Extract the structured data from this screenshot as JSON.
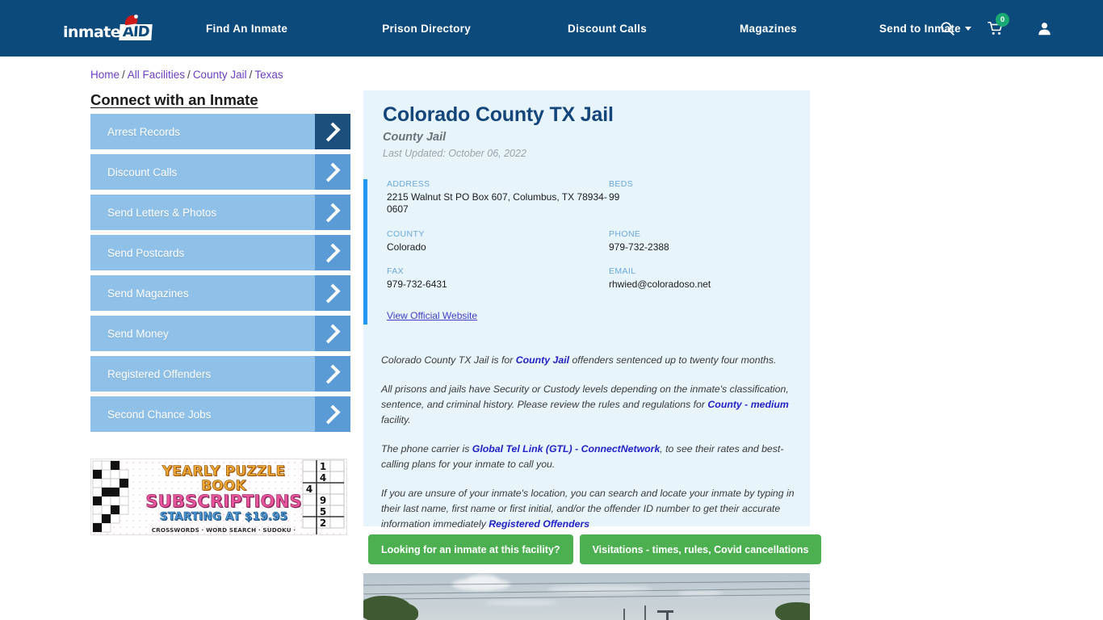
{
  "header": {
    "logo": {
      "text_primary": "inmate",
      "text_secondary": "AID",
      "icon": "santa-hat-icon"
    },
    "nav": [
      {
        "label": "Find An Inmate"
      },
      {
        "label": "Prison Directory"
      },
      {
        "label": "Discount Calls"
      },
      {
        "label": "Magazines"
      },
      {
        "label": "Send to Inmate"
      }
    ],
    "icons": {
      "search": "search-icon",
      "cart": "shopping-cart-icon",
      "cart_count": "0",
      "account": "user-account-icon"
    },
    "colors": {
      "background": "#0d4a7c",
      "badge": "#19a974"
    }
  },
  "breadcrumb": {
    "items": [
      "Home",
      "All Facilities",
      "County Jail",
      "Texas"
    ],
    "separator": "/"
  },
  "sidebar": {
    "title": "Connect with an Inmate",
    "items": [
      {
        "label": "Arrest Records"
      },
      {
        "label": "Discount Calls"
      },
      {
        "label": "Send Letters & Photos"
      },
      {
        "label": "Send Postcards"
      },
      {
        "label": "Send Magazines"
      },
      {
        "label": "Send Money"
      },
      {
        "label": "Registered Offenders"
      },
      {
        "label": "Second Chance Jobs"
      }
    ],
    "ad": {
      "line1": "YEARLY PUZZLE BOOK",
      "line2": "SUBSCRIPTIONS",
      "line3": "STARTING AT $19.95",
      "line4": "CROSSWORDS · WORD SEARCH · SUDOKU · BRAIN TEASERS",
      "sudoku_digits": [
        "1",
        "4",
        "4",
        "9",
        "5",
        "2"
      ]
    }
  },
  "facility": {
    "title": "Colorado County TX Jail",
    "subtitle": "County Jail",
    "last_updated": "Last Updated: October 06, 2022",
    "fields": [
      {
        "label": "ADDRESS",
        "value": "2215 Walnut St PO Box 607, Columbus, TX 78934-0607"
      },
      {
        "label": "BEDS",
        "value": "99"
      },
      {
        "label": "COUNTY",
        "value": "Colorado"
      },
      {
        "label": "PHONE",
        "value": "979-732-2388"
      },
      {
        "label": "FAX",
        "value": "979-732-6431"
      },
      {
        "label": "EMAIL",
        "value": "rhwied@coloradoso.net"
      }
    ],
    "official_website_link": "View Official Website"
  },
  "description": {
    "p1_a": "Colorado County TX Jail is for ",
    "p1_link": "County Jail",
    "p1_b": " offenders sentenced up to twenty four months.",
    "p2_a": "All prisons and jails have Security or Custody levels depending on the inmate's classification, sentence, and criminal history. Please review the rules and regulations for ",
    "p2_link": "County - medium",
    "p2_b": " facility.",
    "p3_a": "The phone carrier is ",
    "p3_link": "Global Tel Link (GTL) - ConnectNetwork",
    "p3_b": ", to see their rates and best-calling plans for your inmate to call you.",
    "p4_a": "If you are unsure of your inmate's location, you can search and locate your inmate by typing in their last name, first name or first initial, and/or the offender ID number to get their accurate information immediately ",
    "p4_link": "Registered Offenders"
  },
  "actions": {
    "inmate_search_label": "Looking for an inmate at this facility?",
    "visitations_label": "Visitations - times, rules, Covid cancellations",
    "color": "#4caf50"
  },
  "photo": {
    "alt": "facility-street-view-photo"
  }
}
